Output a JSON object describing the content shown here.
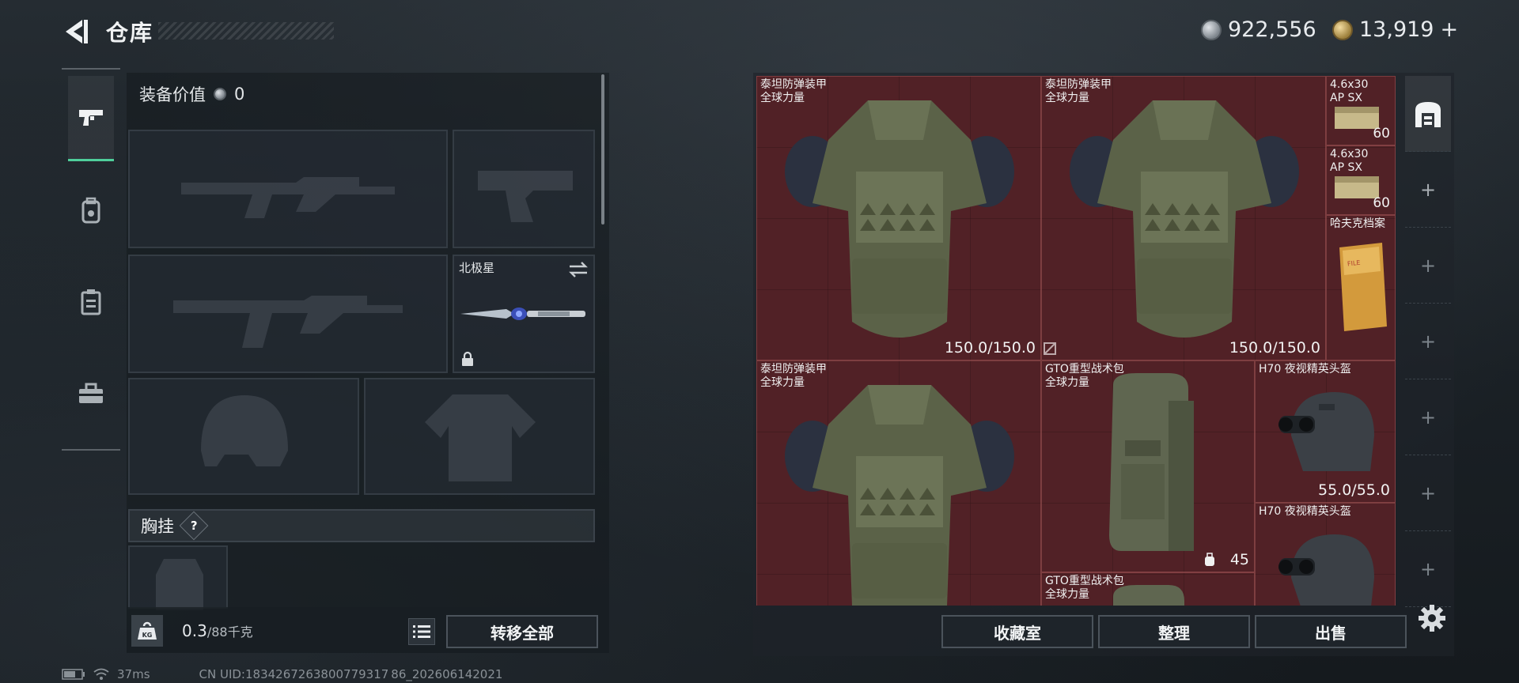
{
  "header": {
    "title": "仓库",
    "currency": [
      {
        "icon": "silver-coin-icon",
        "amount": "922,556"
      },
      {
        "icon": "gold-coin-icon",
        "amount": "13,919",
        "suffix": "+"
      }
    ]
  },
  "tabs": [
    {
      "icon": "pistol-icon",
      "active": true
    },
    {
      "icon": "backpack-icon",
      "active": false
    },
    {
      "icon": "clipboard-icon",
      "active": false
    },
    {
      "icon": "toolbox-icon",
      "active": false
    }
  ],
  "equipment": {
    "value_label": "装备价值",
    "value_amount": "0",
    "melee_slot_name": "北极星",
    "chest_rig_label": "胸挂",
    "chest_rig_help": "?"
  },
  "weight": {
    "current": "0.3",
    "max": "/88千克"
  },
  "left_actions": {
    "transfer_all": "转移全部"
  },
  "stash_items": [
    {
      "name": "泰坦防弹装甲",
      "sub": "全球力量",
      "value": "150.0/150.0"
    },
    {
      "name": "泰坦防弹装甲",
      "sub": "全球力量",
      "value": "150.0/150.0"
    },
    {
      "name": "4.6x30",
      "sub": "AP SX",
      "value": "60"
    },
    {
      "name": "4.6x30",
      "sub": "AP SX",
      "value": "60"
    },
    {
      "name": "哈夫克档案",
      "sub": "",
      "value": ""
    },
    {
      "name": "泰坦防弹装甲",
      "sub": "全球力量",
      "value": ""
    },
    {
      "name": "GTO重型战术包",
      "sub": "全球力量",
      "value": "45"
    },
    {
      "name": "H70 夜视精英头盔",
      "sub": "",
      "value": "55.0/55.0"
    },
    {
      "name": "H70 夜视精英头盔",
      "sub": "",
      "value": ""
    },
    {
      "name": "GTO重型战术包",
      "sub": "全球力量",
      "value": ""
    }
  ],
  "stash_actions": {
    "collection": "收藏室",
    "sort": "整理",
    "sell": "出售"
  },
  "status_bar": {
    "ping": "37ms",
    "uid": "CN UID:1834267263800779317 86_202606142021"
  }
}
